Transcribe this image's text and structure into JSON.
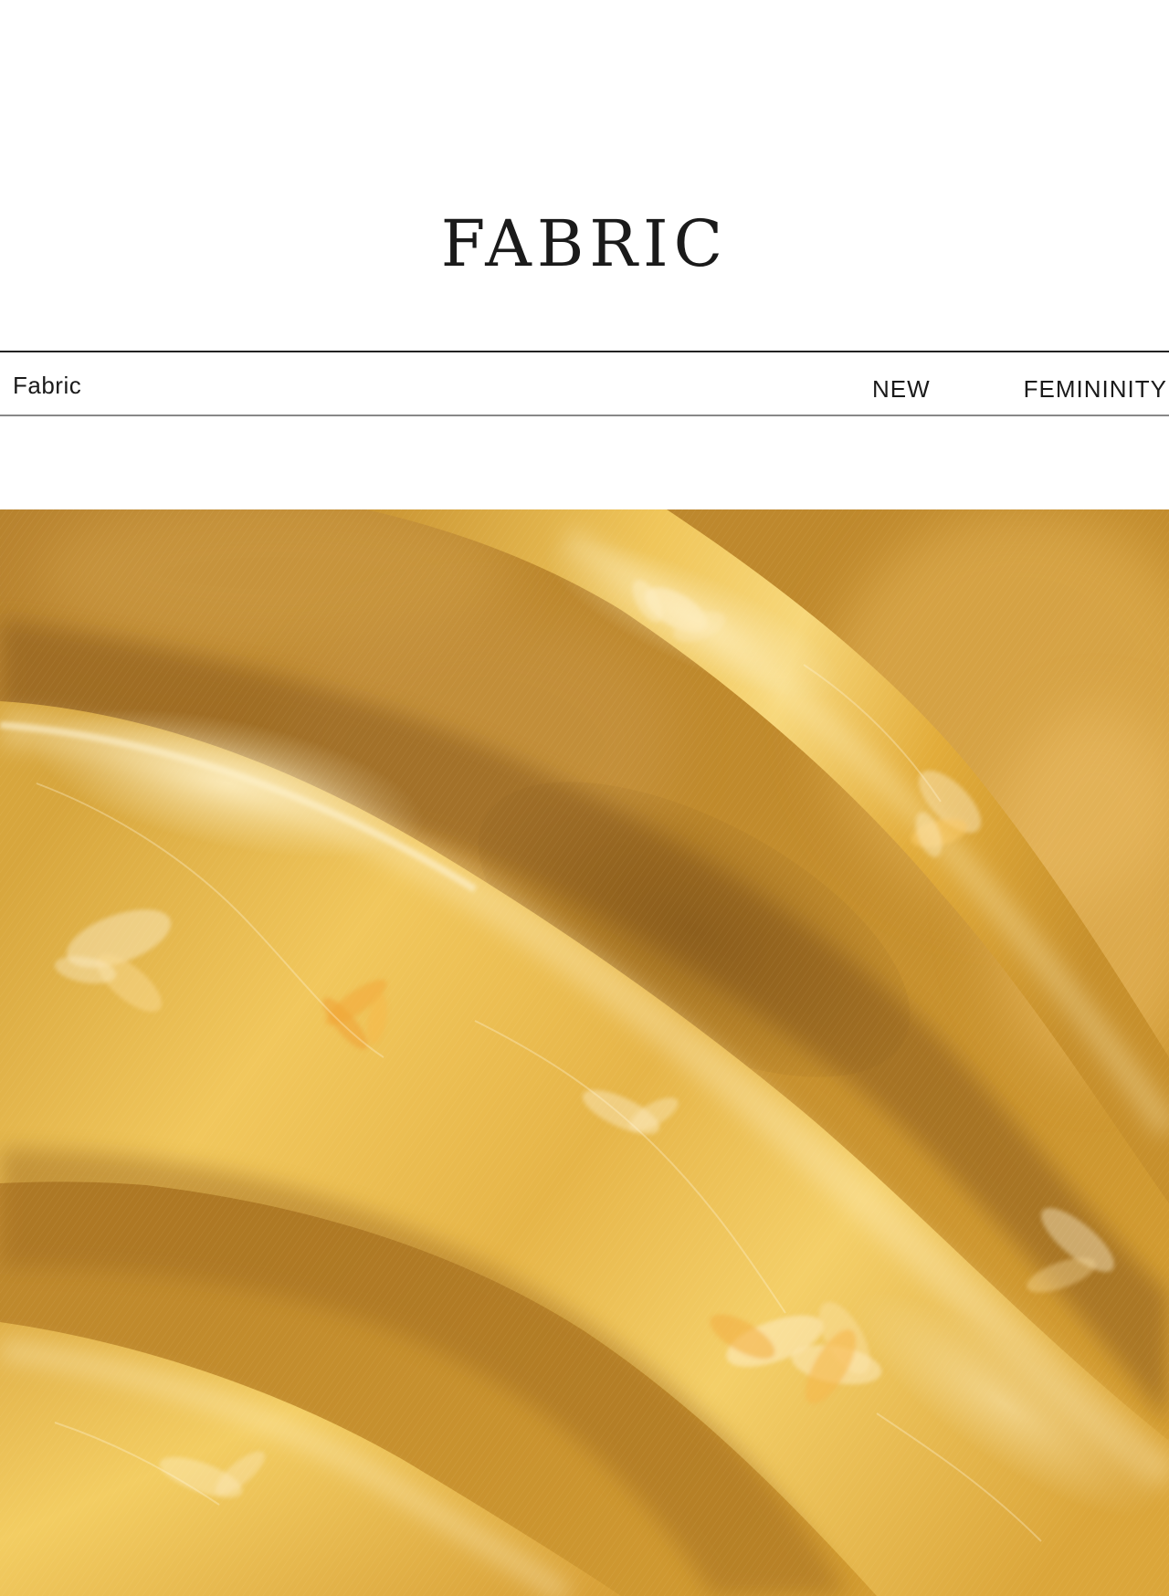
{
  "header": {
    "title": "FABRIC"
  },
  "band": {
    "left_label": "Fabric",
    "mid_label": "NEW",
    "right_label": "FEMININITY"
  },
  "photo": {
    "subject": "fabric-photo",
    "colors": {
      "base": "#b8822c",
      "highlight": "#f3c95a",
      "shadow": "#8e5e1c",
      "sheen": "#fff1c4"
    }
  }
}
